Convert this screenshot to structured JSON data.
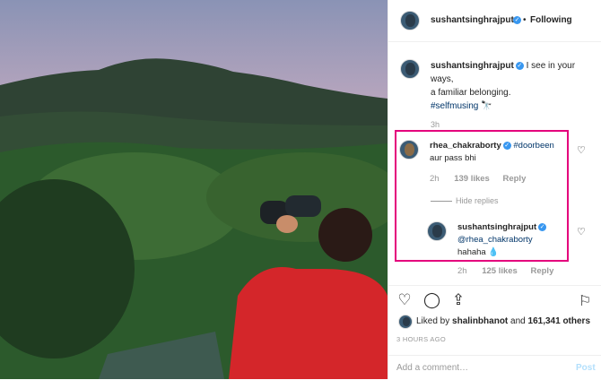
{
  "post": {
    "username": "sushantsinghrajput",
    "following_label": "Following",
    "separator": "•",
    "caption_line1": "I see in your ways,",
    "caption_line2": "a familiar belonging.",
    "hashtag": "#selfmusing",
    "caption_emoji": "🔭",
    "caption_time": "3h"
  },
  "comments": [
    {
      "username": "rhea_chakraborty",
      "tag": "#doorbeen",
      "text": "aur pass bhi",
      "time": "2h",
      "likes": "139 likes",
      "reply": "Reply"
    },
    {
      "username": "sushantsinghrajput",
      "mention": "@rhea_chakraborty",
      "text": "hahaha 💧",
      "time": "2h",
      "likes": "125 likes",
      "reply": "Reply"
    }
  ],
  "hide_replies": "Hide replies",
  "liked_by_prefix": "Liked by",
  "liked_by_user": "shalinbhanot",
  "liked_by_and": "and",
  "liked_by_others": "161,341 others",
  "timestamp": "3 HOURS AGO",
  "add_comment_placeholder": "Add a comment…",
  "post_label": "Post",
  "colors": {
    "accent": "#3897f0",
    "highlight": "#e4007c"
  }
}
